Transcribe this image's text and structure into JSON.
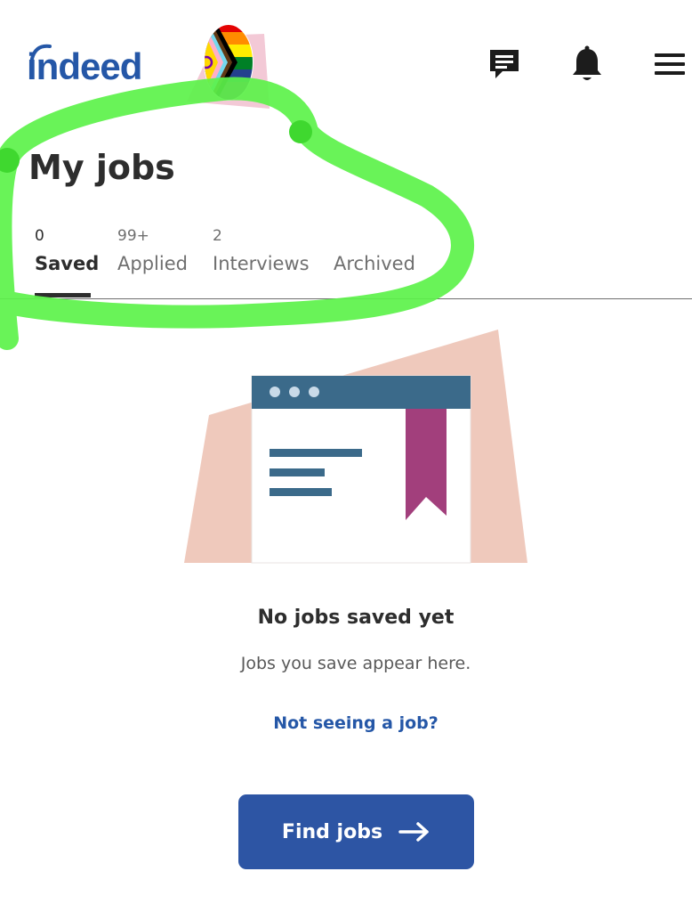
{
  "header": {
    "logo_text": "indeed",
    "icons": {
      "messages": "messages-icon",
      "notifications": "bell-icon",
      "menu": "hamburger-menu-icon"
    }
  },
  "page": {
    "title": "My jobs"
  },
  "tabs": [
    {
      "count": "0",
      "label": "Saved",
      "active": true
    },
    {
      "count": "99+",
      "label": "Applied",
      "active": false
    },
    {
      "count": "2",
      "label": "Interviews",
      "active": false
    },
    {
      "count": "",
      "label": "Archived",
      "active": false
    }
  ],
  "empty_state": {
    "title": "No jobs saved yet",
    "subtitle": "Jobs you save appear here.",
    "link_text": "Not seeing a job?",
    "button_label": "Find jobs",
    "button_icon": "arrow-right-icon"
  },
  "colors": {
    "brand_blue": "#2557a7",
    "button_blue": "#2d55a4",
    "highlight_green": "#5cf24a",
    "illustration_peach": "#efc9bc",
    "bookmark_magenta": "#a23f7c",
    "window_bar": "#3b6a8a"
  }
}
